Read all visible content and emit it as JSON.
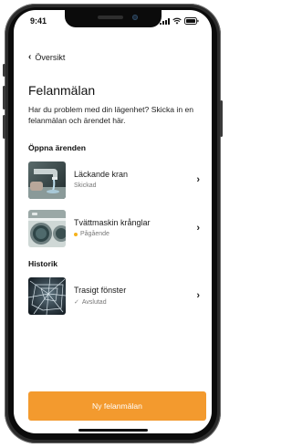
{
  "status_bar": {
    "time": "9:41"
  },
  "navigation": {
    "back_label": "Översikt",
    "back_icon": "chevron-left-icon"
  },
  "page": {
    "title": "Felanmälan",
    "description": "Har du problem med din lägenhet? Skicka in en felanmälan och ärendet här."
  },
  "open_cases": {
    "heading": "Öppna ärenden",
    "items": [
      {
        "title": "Läckande kran",
        "status": "Skickad",
        "thumbnail": "faucet-photo"
      },
      {
        "title": "Tvättmaskin krånglar",
        "status": "Pågående",
        "status_color": "#f5b21b",
        "thumbnail": "washing-machine-photo"
      }
    ]
  },
  "history": {
    "heading": "Historik",
    "items": [
      {
        "title": "Trasigt fönster",
        "status": "Avslutad",
        "status_icon": "check-icon",
        "thumbnail": "broken-window-photo"
      }
    ]
  },
  "primary_action": {
    "label": "Ny felanmälan",
    "color": "#f39a2e"
  }
}
